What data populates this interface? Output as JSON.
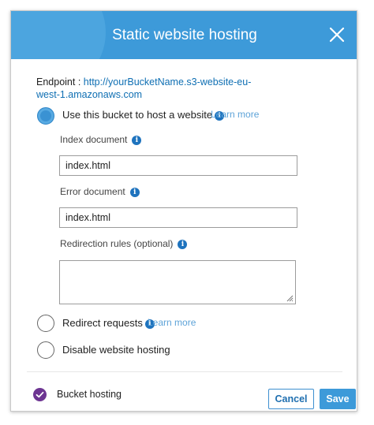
{
  "dialog": {
    "title": "Static website hosting",
    "close_icon": "close-icon"
  },
  "endpoint": {
    "label": "Endpoint : ",
    "url": "http://yourBucketName.s3-website-eu-west-1.amazonaws.com"
  },
  "options": {
    "host": {
      "label": "Use this bucket to host a website",
      "learn_more": "Learn more",
      "selected": true
    },
    "redirect": {
      "label": "Redirect requests",
      "learn_more": "Learn more",
      "selected": false
    },
    "disable": {
      "label": "Disable website hosting",
      "selected": false
    }
  },
  "fields": {
    "index_document": {
      "label": "Index document",
      "value": "index.html"
    },
    "error_document": {
      "label": "Error document",
      "value": "index.html"
    },
    "redirection_rules": {
      "label": "Redirection rules (optional)",
      "value": ""
    }
  },
  "footer": {
    "status_label": "Bucket hosting",
    "cancel_label": "Cancel",
    "save_label": "Save"
  },
  "colors": {
    "header": "#3d9ad9",
    "link": "#0f6fb3",
    "badge": "#6d3592"
  }
}
